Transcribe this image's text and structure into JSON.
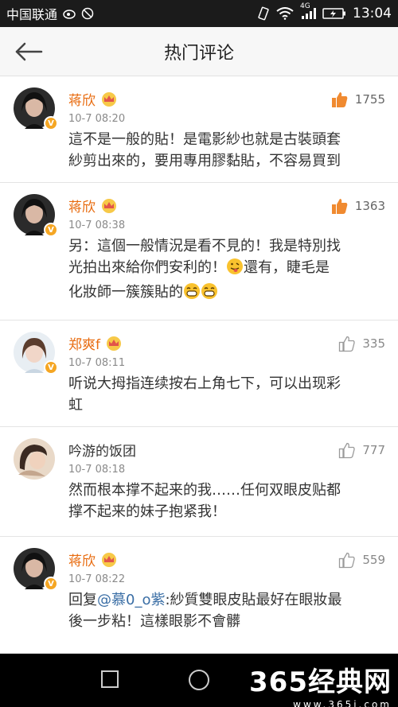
{
  "status_bar": {
    "carrier": "中国联通",
    "network": "4G",
    "time": "13:04"
  },
  "header": {
    "title": "热门评论"
  },
  "comments": [
    {
      "username": "蒋欣",
      "verified": true,
      "vip": true,
      "time": "10-7 08:20",
      "likes": "1755",
      "liked_hot": true,
      "lines": [
        "這不是一般的貼！是電影紗也就是古裝頭套",
        "紗剪出來的，要用專用膠黏貼，不容易買到"
      ]
    },
    {
      "username": "蒋欣",
      "verified": true,
      "vip": true,
      "time": "10-7 08:38",
      "likes": "1363",
      "liked_hot": true,
      "lines": [
        "另：這個一般情況是看不見的！我是特別找",
        "光拍出來給你們安利的！",
        "還有，睫毛是",
        "化妝師一簇簇貼的"
      ]
    },
    {
      "username": "郑爽f",
      "verified": true,
      "vip": true,
      "time": "10-7 08:11",
      "likes": "335",
      "liked_hot": false,
      "lines": [
        "听说大拇指连续按右上角七下，可以出现彩",
        "虹"
      ]
    },
    {
      "username": "吟游的饭团",
      "verified": false,
      "vip": false,
      "time": "10-7 08:18",
      "likes": "777",
      "liked_hot": false,
      "lines": [
        "然而根本撑不起来的我……任何双眼皮贴都",
        "撑不起来的妹子抱紧我！"
      ]
    },
    {
      "username": "蒋欣",
      "verified": true,
      "vip": true,
      "time": "10-7 08:22",
      "likes": "559",
      "liked_hot": false,
      "reply_prefix": "回复",
      "mention": "@慕0_o紫",
      "lines": [
        ":紗質雙眼皮貼最好在眼妝最",
        "後一步粘！這樣眼影不會髒"
      ]
    }
  ],
  "watermark": {
    "main": "365经典网",
    "url": "www.365j.com"
  },
  "colors": {
    "username": "#e86b0f",
    "like_hot": "#f08a30",
    "mention": "#3a6ea5",
    "vip_badge": "#f5a623"
  }
}
